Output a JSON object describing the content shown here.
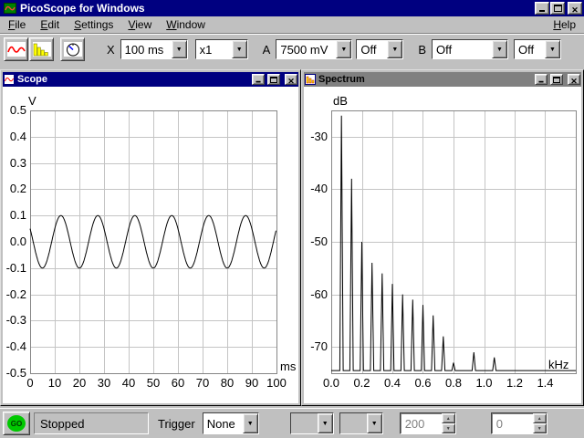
{
  "window": {
    "title": "PicoScope for Windows"
  },
  "menu": {
    "items": [
      "File",
      "Edit",
      "Settings",
      "View",
      "Window"
    ],
    "help": "Help"
  },
  "toolbar": {
    "x_label": "X",
    "timebase": "100 ms",
    "multiplier": "x1",
    "a_label": "A",
    "a_range": "7500 mV",
    "a_coupling": "Off",
    "b_label": "B",
    "b_range": "Off",
    "b_coupling": "Off"
  },
  "scope": {
    "title": "Scope",
    "y_unit": "V",
    "x_unit": "ms",
    "v_top": 0.5,
    "v_bottom": -0.5,
    "y_ticks": [
      0.5,
      0.4,
      0.3,
      0.2,
      0.1,
      0,
      -0.1,
      -0.2,
      -0.3,
      -0.4,
      -0.5
    ],
    "ms_max": 100,
    "x_ticks": [
      0,
      10,
      20,
      30,
      40,
      50,
      60,
      70,
      80,
      90,
      100
    ],
    "wave": {
      "type": "sine",
      "amplitude_v": 0.1,
      "period_ms": 15,
      "phase_deg": 150
    }
  },
  "spectrum": {
    "title": "Spectrum",
    "y_unit": "dB",
    "x_unit": "kHz",
    "db_top": -25,
    "db_bottom": -75,
    "y_ticks": [
      -30,
      -40,
      -50,
      -60,
      -70
    ],
    "khz_max": 1.6,
    "x_ticks": [
      0,
      0.2,
      0.4,
      0.6,
      0.8,
      1.0,
      1.2,
      1.4
    ],
    "floor_db": -74.5,
    "peaks": [
      [
        0.067,
        -26
      ],
      [
        0.133,
        -38
      ],
      [
        0.2,
        -50
      ],
      [
        0.267,
        -54
      ],
      [
        0.333,
        -56
      ],
      [
        0.4,
        -58
      ],
      [
        0.467,
        -60
      ],
      [
        0.533,
        -61
      ],
      [
        0.6,
        -62
      ],
      [
        0.667,
        -64
      ],
      [
        0.733,
        -68
      ],
      [
        0.8,
        -73
      ],
      [
        0.933,
        -71
      ],
      [
        1.067,
        -72
      ]
    ]
  },
  "statusbar": {
    "go_label": "GO",
    "status_text": "Stopped",
    "trigger_label": "Trigger",
    "trigger_mode": "None",
    "trigger_channel": "",
    "trigger_direction": "",
    "trigger_threshold": "200",
    "trigger_delay": "0"
  },
  "colors": {
    "titlebar_active": "#000080",
    "titlebar_inactive": "#808080",
    "chrome": "#c0c0c0",
    "plot_background": "#ffffff",
    "grid": "#c4c4c4",
    "trace": "#000000",
    "go_green": "#00c800"
  }
}
